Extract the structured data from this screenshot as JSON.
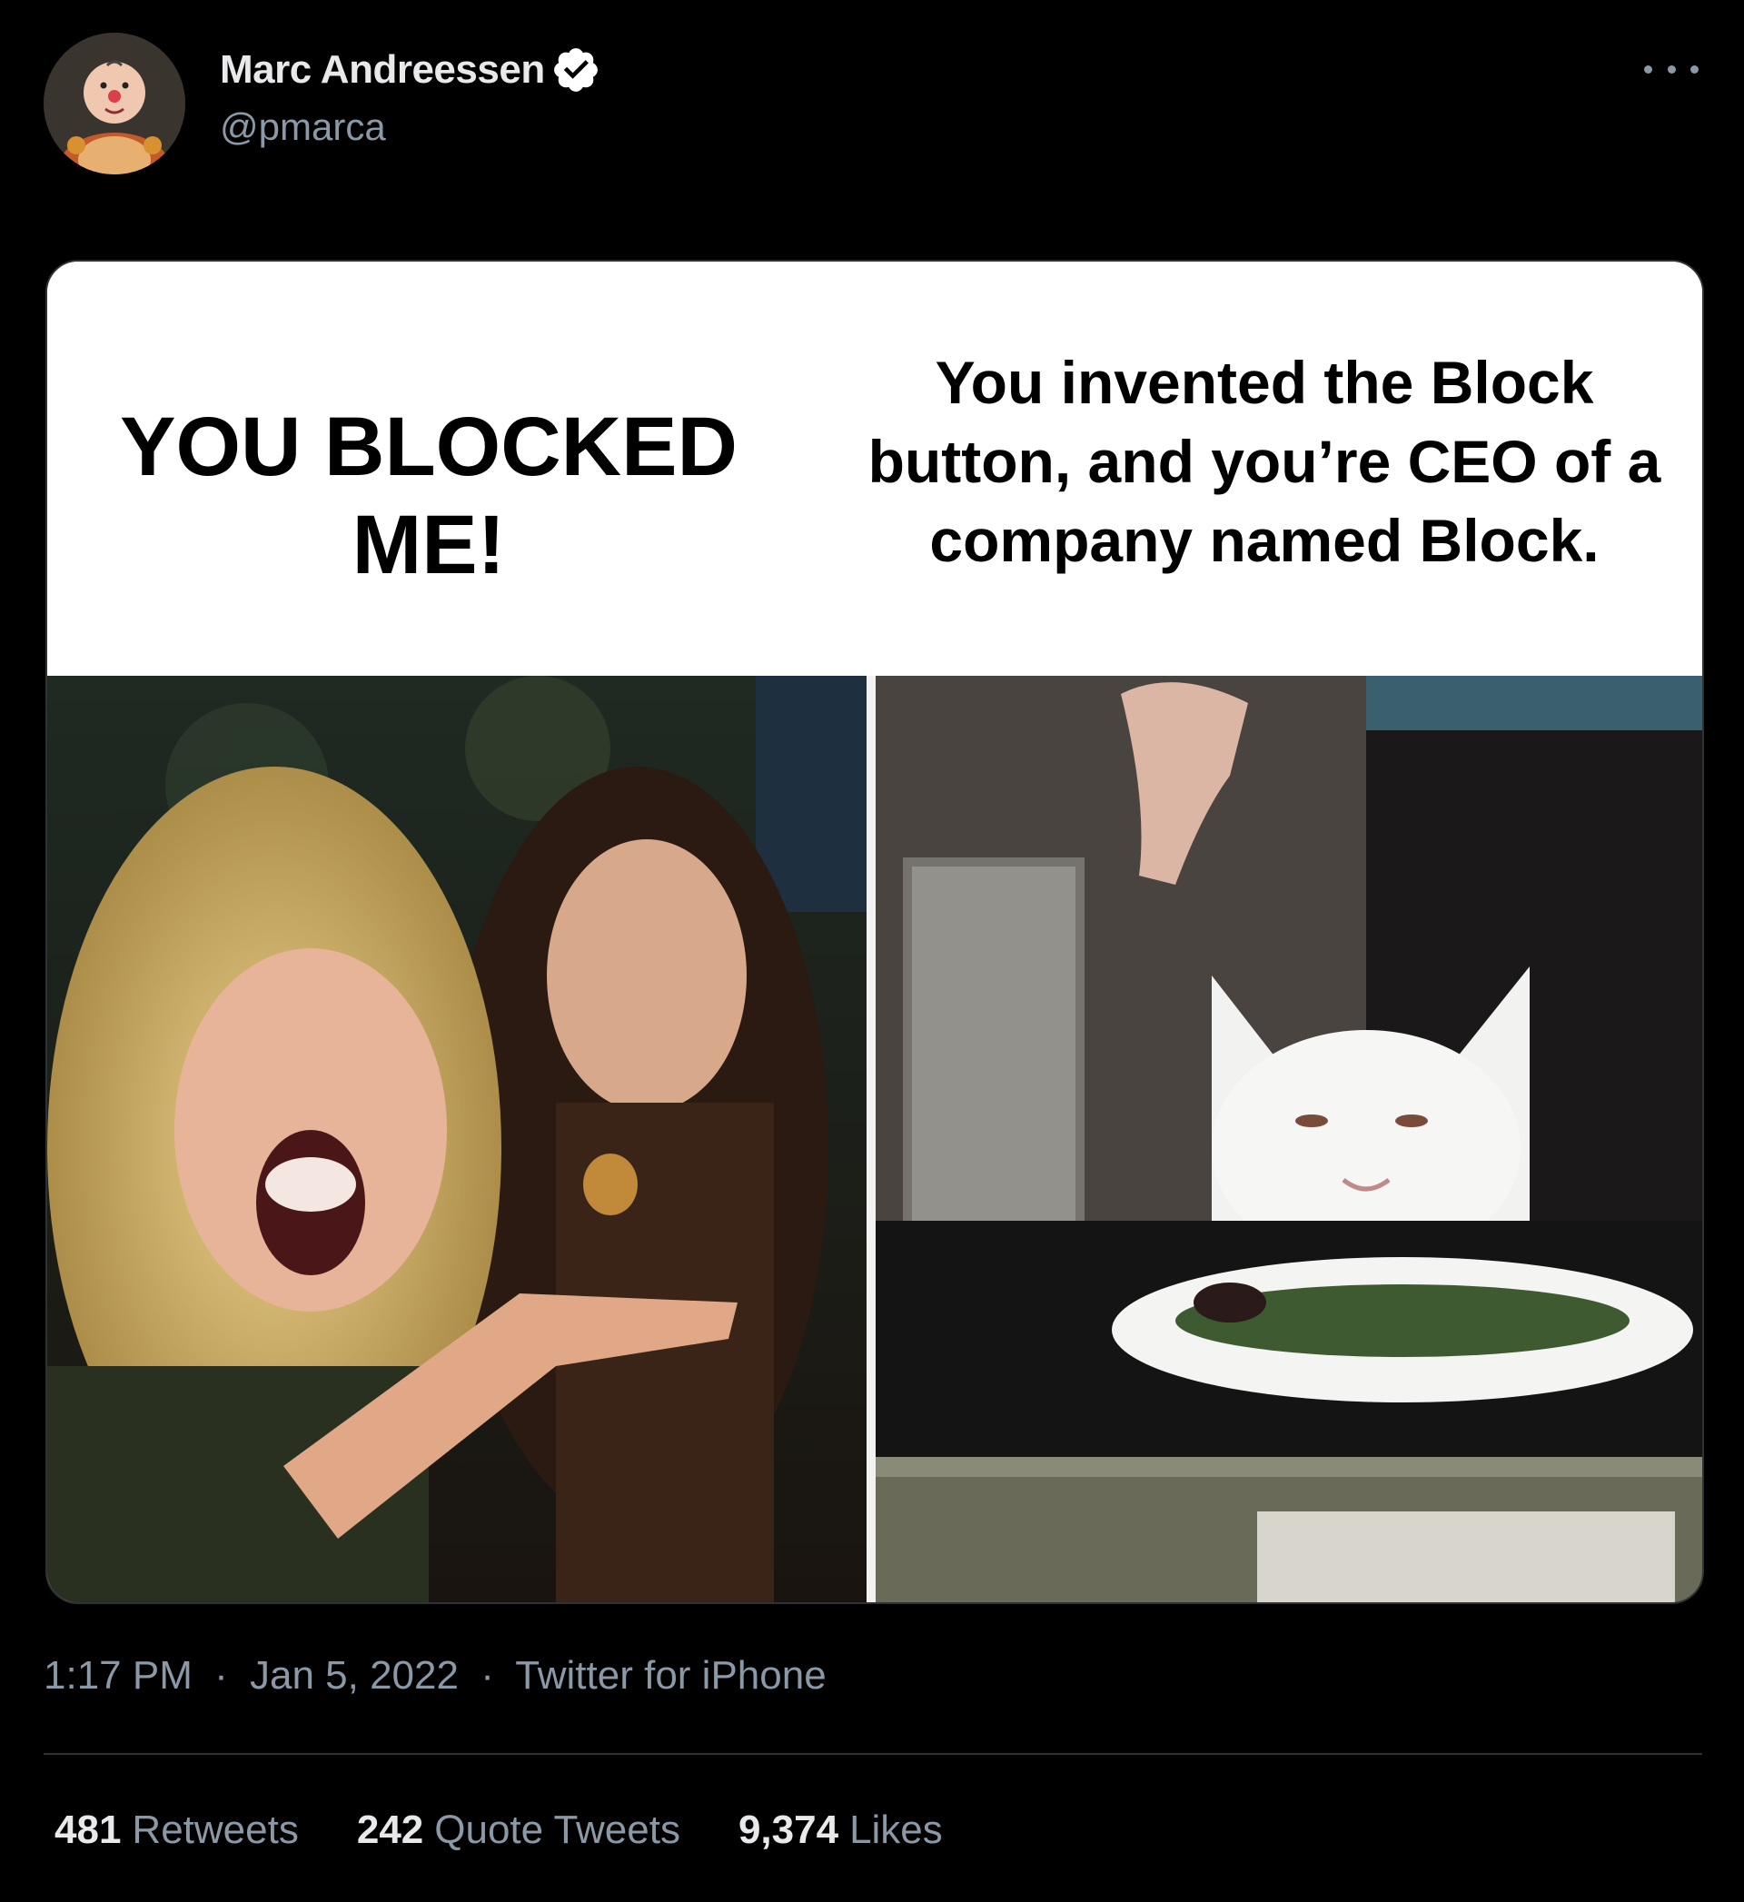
{
  "author": {
    "name": "Marc Andreessen",
    "handle": "@pmarca",
    "verified": true,
    "avatar_icon": "cartoon-avatar-icon"
  },
  "menu": {
    "more_icon": "more-horizontal-icon"
  },
  "media": {
    "caption_left": "YOU BLOCKED ME!",
    "caption_right": "You invented the Block button, and you’re CEO of a company named Block."
  },
  "meta": {
    "time": "1:17 PM",
    "separator": "·",
    "date": "Jan 5, 2022",
    "source": "Twitter for iPhone"
  },
  "stats": {
    "retweets": {
      "count": "481",
      "label": "Retweets"
    },
    "quote_tweets": {
      "count": "242",
      "label": "Quote Tweets"
    },
    "likes": {
      "count": "9,374",
      "label": "Likes"
    }
  },
  "colors": {
    "background": "#000000",
    "primary_text": "#e7e9ea",
    "secondary_text": "#8b98a5",
    "divider": "#2f3336",
    "verified_badge": "#ffffff"
  }
}
